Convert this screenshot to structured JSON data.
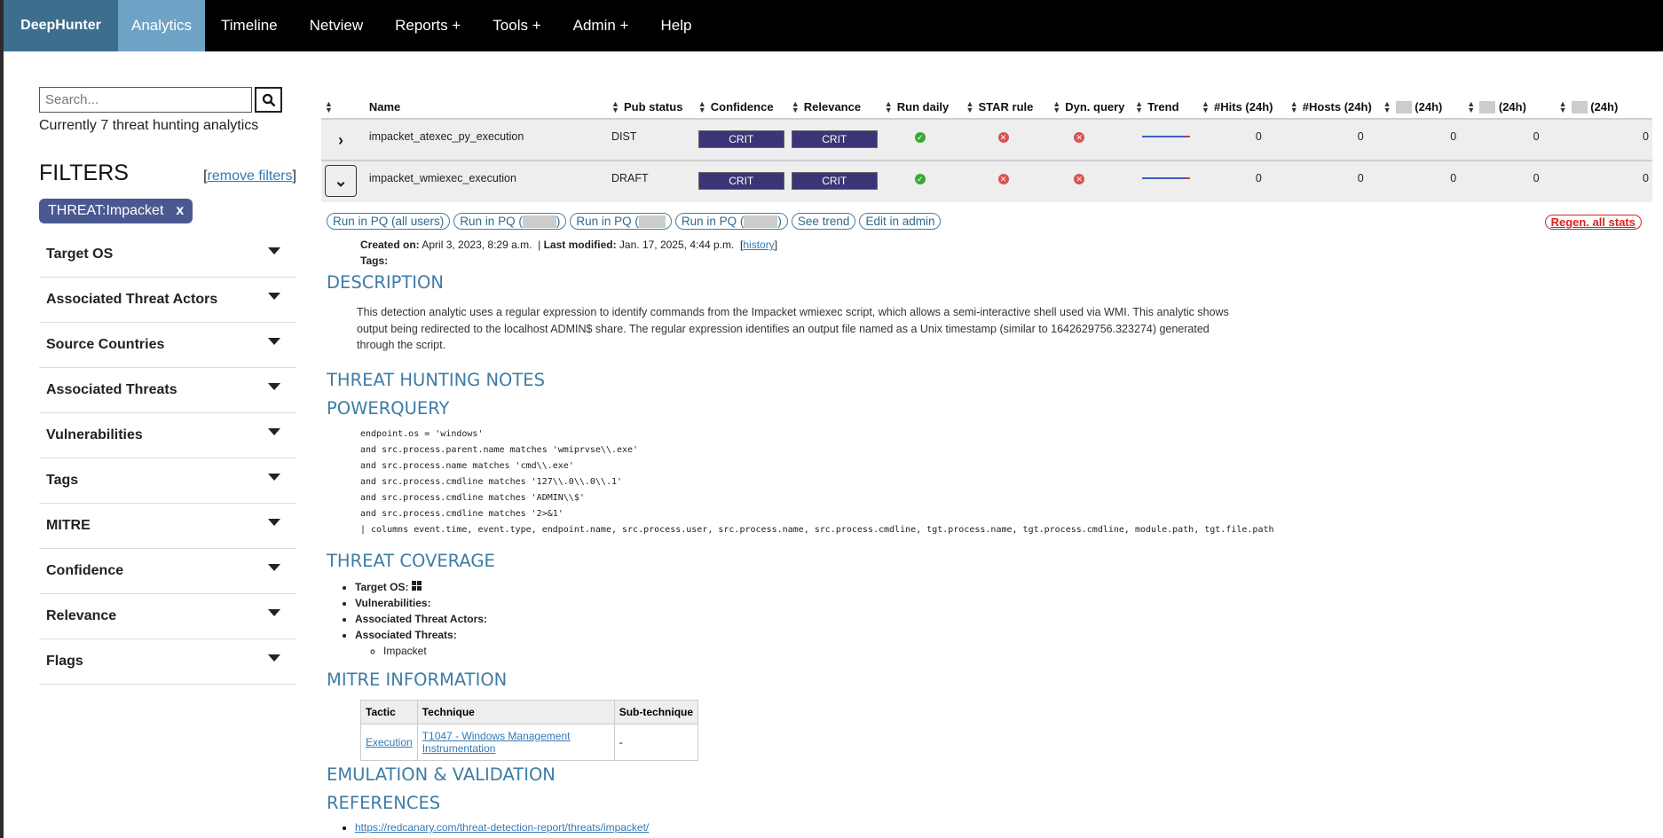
{
  "navbar": {
    "brand": "DeepHunter",
    "items": [
      {
        "label": "Analytics"
      },
      {
        "label": "Timeline"
      },
      {
        "label": "Netview"
      },
      {
        "label": "Reports +"
      },
      {
        "label": "Tools +"
      },
      {
        "label": "Admin +"
      },
      {
        "label": "Help"
      }
    ]
  },
  "sidebar": {
    "search_placeholder": "Search...",
    "count_text": "Currently 7 threat hunting analytics",
    "filters_title": "FILTERS",
    "remove_filters": "remove filters",
    "active_chip": "THREAT:Impacket",
    "filters": [
      "Target OS",
      "Associated Threat Actors",
      "Source Countries",
      "Associated Threats",
      "Vulnerabilities",
      "Tags",
      "MITRE",
      "Confidence",
      "Relevance",
      "Flags"
    ]
  },
  "table": {
    "columns": [
      "Name",
      "Pub status",
      "Confidence",
      "Relevance",
      "Run daily",
      "STAR rule",
      "Dyn. query",
      "Trend",
      "#Hits (24h)",
      "#Hosts (24h)",
      "(24h)",
      "(24h)",
      "(24h)"
    ],
    "rows": [
      {
        "name": "impacket_atexec_py_execution",
        "pub_status": "DIST",
        "confidence": "CRIT",
        "relevance": "CRIT",
        "hits": "0",
        "hosts": "0",
        "c1": "0",
        "c2": "0",
        "c3": "0"
      },
      {
        "name": "impacket_wmiexec_execution",
        "pub_status": "DRAFT",
        "confidence": "CRIT",
        "relevance": "CRIT",
        "hits": "0",
        "hosts": "0",
        "c1": "0",
        "c2": "0",
        "c3": "0"
      }
    ]
  },
  "detail": {
    "buttons": [
      "Run in PQ (all users)",
      "Run in PQ (",
      "Run in PQ (",
      "Run in PQ (",
      "See trend",
      "Edit in admin"
    ],
    "regen": "Regen. all stats",
    "created_label": "Created on:",
    "created_value": "April 3, 2023, 8:29 a.m.",
    "modified_label": "Last modified:",
    "modified_value": "Jan. 17, 2025, 4:44 p.m.",
    "history": "history",
    "tags_label": "Tags:",
    "description_title": "DESCRIPTION",
    "description": "This detection analytic uses a regular expression to identify commands from the Impacket wmiexec script, which allows a semi-interactive shell used via WMI. This analytic shows output being redirected to the localhost ADMIN$ share. The regular expression identifies an output file named as a Unix timestamp (similar to 1642629756.323274) generated through the script.",
    "notes_title": "THREAT HUNTING NOTES",
    "pq_title": "POWERQUERY",
    "query": "endpoint.os = 'windows'\nand src.process.parent.name matches 'wmiprvse\\\\.exe'\nand src.process.name matches 'cmd\\\\.exe'\nand src.process.cmdline matches '127\\\\.0\\\\.0\\\\.1'\nand src.process.cmdline matches 'ADMIN\\\\$'\nand src.process.cmdline matches '2>&1'\n| columns event.time, event.type, endpoint.name, src.process.user, src.process.name, src.process.cmdline, tgt.process.name, tgt.process.cmdline, module.path, tgt.file.path",
    "coverage_title": "THREAT COVERAGE",
    "cov_target_os": "Target OS:",
    "cov_vuln": "Vulnerabilities:",
    "cov_actors": "Associated Threat Actors:",
    "cov_threats": "Associated Threats:",
    "cov_threat_item": "Impacket",
    "mitre_title": "MITRE INFORMATION",
    "mitre_headers": [
      "Tactic",
      "Technique",
      "Sub-technique"
    ],
    "mitre_row": {
      "tactic": "Execution",
      "technique": "T1047 - Windows Management Instrumentation",
      "sub": "-"
    },
    "emulation_title": "EMULATION & VALIDATION",
    "references_title": "REFERENCES",
    "reference": "https://redcanary.com/threat-detection-report/threats/impacket/"
  }
}
